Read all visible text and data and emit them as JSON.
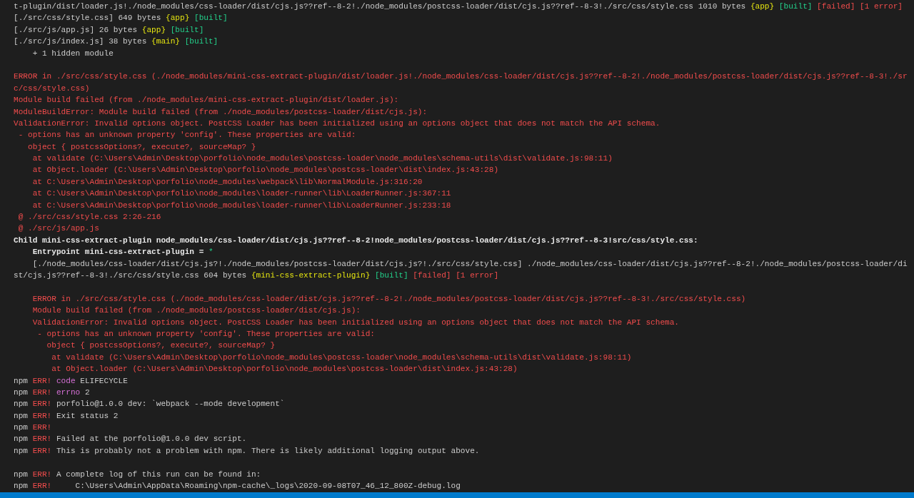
{
  "terminal": {
    "lines": [
      {
        "kind": "text",
        "segments": [
          {
            "text": "t-plugin/dist/loader.js!./node_modules/css-loader/dist/cjs.js??ref--8-2!./node_modules/postcss-loader/dist/cjs.js??ref--8-3!./src/css/style.css 1010 bytes",
            "kind": "plain"
          },
          {
            "text": "{app}",
            "kind": "chunk"
          },
          {
            "text": "[built]",
            "kind": "ok"
          },
          {
            "text": "[failed]",
            "kind": "error"
          },
          {
            "text": "[1 error]",
            "kind": "error"
          }
        ]
      },
      {
        "kind": "text",
        "segments": [
          {
            "text": "[./src/css/style.css] 649 bytes",
            "kind": "plain"
          },
          {
            "text": "{app}",
            "kind": "chunk"
          },
          {
            "text": "[built]",
            "kind": "ok"
          }
        ]
      },
      {
        "kind": "text",
        "segments": [
          {
            "text": "[./src/js/app.js] 26 bytes",
            "kind": "plain"
          },
          {
            "text": "{app}",
            "kind": "chunk"
          },
          {
            "text": "[built]",
            "kind": "ok"
          }
        ]
      },
      {
        "kind": "text",
        "segments": [
          {
            "text": "[./src/js/index.js] 38 bytes",
            "kind": "plain"
          },
          {
            "text": "{main}",
            "kind": "chunk"
          },
          {
            "text": "[built]",
            "kind": "ok"
          }
        ]
      },
      {
        "kind": "text",
        "segments": [
          {
            "text": "    + 1 hidden module",
            "kind": "plain"
          }
        ]
      },
      {
        "kind": "blank"
      },
      {
        "kind": "text",
        "segments": [
          {
            "text": "ERROR in ./src/css/style.css (./node_modules/mini-css-extract-plugin/dist/loader.js!./node_modules/css-loader/dist/cjs.js??ref--8-2!./node_modules/postcss-loader/dist/cjs.js??ref--8-3!./sr",
            "kind": "error"
          }
        ]
      },
      {
        "kind": "text",
        "segments": [
          {
            "text": "c/css/style.css)",
            "kind": "error"
          }
        ]
      },
      {
        "kind": "text",
        "segments": [
          {
            "text": "Module build failed (from ./node_modules/mini-css-extract-plugin/dist/loader.js):",
            "kind": "error"
          }
        ]
      },
      {
        "kind": "text",
        "segments": [
          {
            "text": "ModuleBuildError: Module build failed (from ./node_modules/postcss-loader/dist/cjs.js):",
            "kind": "error"
          }
        ]
      },
      {
        "kind": "text",
        "segments": [
          {
            "text": "ValidationError: Invalid options object. PostCSS Loader has been initialized using an options object that does not match the API schema.",
            "kind": "error"
          }
        ]
      },
      {
        "kind": "text",
        "segments": [
          {
            "text": " - options has an unknown property 'config'. These properties are valid:",
            "kind": "error"
          }
        ]
      },
      {
        "kind": "text",
        "segments": [
          {
            "text": "   object { postcssOptions?, execute?, sourceMap? }",
            "kind": "error"
          }
        ]
      },
      {
        "kind": "text",
        "segments": [
          {
            "text": "    at validate (C:\\Users\\Admin\\Desktop\\porfolio\\node_modules\\postcss-loader\\node_modules\\schema-utils\\dist\\validate.js:98:11)",
            "kind": "error"
          }
        ]
      },
      {
        "kind": "text",
        "segments": [
          {
            "text": "    at Object.loader (C:\\Users\\Admin\\Desktop\\porfolio\\node_modules\\postcss-loader\\dist\\index.js:43:28)",
            "kind": "error"
          }
        ]
      },
      {
        "kind": "text",
        "segments": [
          {
            "text": "    at C:\\Users\\Admin\\Desktop\\porfolio\\node_modules\\webpack\\lib\\NormalModule.js:316:20",
            "kind": "error"
          }
        ]
      },
      {
        "kind": "text",
        "segments": [
          {
            "text": "    at C:\\Users\\Admin\\Desktop\\porfolio\\node_modules\\loader-runner\\lib\\LoaderRunner.js:367:11",
            "kind": "error"
          }
        ]
      },
      {
        "kind": "text",
        "segments": [
          {
            "text": "    at C:\\Users\\Admin\\Desktop\\porfolio\\node_modules\\loader-runner\\lib\\LoaderRunner.js:233:18",
            "kind": "error"
          }
        ]
      },
      {
        "kind": "text",
        "segments": [
          {
            "text": " @ ./src/css/style.css 2:26-216",
            "kind": "error"
          }
        ]
      },
      {
        "kind": "text",
        "segments": [
          {
            "text": " @ ./src/js/app.js",
            "kind": "error"
          }
        ]
      },
      {
        "kind": "text",
        "segments": [
          {
            "text": "Child mini-css-extract-plugin node_modules/css-loader/dist/cjs.js??ref--8-2!node_modules/postcss-loader/dist/cjs.js??ref--8-3!src/css/style.css:",
            "kind": "bold"
          }
        ]
      },
      {
        "kind": "text",
        "segments": [
          {
            "text": "    Entrypoint mini-css-extract-plugin =",
            "kind": "bold"
          },
          {
            "text": "*",
            "kind": "ok"
          }
        ]
      },
      {
        "kind": "text",
        "segments": [
          {
            "text": "    [./node_modules/css-loader/dist/cjs.js?!./node_modules/postcss-loader/dist/cjs.js?!./src/css/style.css] ./node_modules/css-loader/dist/cjs.js??ref--8-2!./node_modules/postcss-loader/di",
            "kind": "plain"
          }
        ]
      },
      {
        "kind": "text",
        "segments": [
          {
            "text": "st/cjs.js??ref--8-3!./src/css/style.css 604 bytes",
            "kind": "plain"
          },
          {
            "text": "{mini-css-extract-plugin}",
            "kind": "chunk"
          },
          {
            "text": "[built]",
            "kind": "ok"
          },
          {
            "text": "[failed]",
            "kind": "error"
          },
          {
            "text": "[1 error]",
            "kind": "error"
          }
        ]
      },
      {
        "kind": "blank"
      },
      {
        "kind": "text",
        "segments": [
          {
            "text": "    ERROR in ./src/css/style.css (./node_modules/css-loader/dist/cjs.js??ref--8-2!./node_modules/postcss-loader/dist/cjs.js??ref--8-3!./src/css/style.css)",
            "kind": "error"
          }
        ]
      },
      {
        "kind": "text",
        "segments": [
          {
            "text": "    Module build failed (from ./node_modules/postcss-loader/dist/cjs.js):",
            "kind": "error"
          }
        ]
      },
      {
        "kind": "text",
        "segments": [
          {
            "text": "    ValidationError: Invalid options object. PostCSS Loader has been initialized using an options object that does not match the API schema.",
            "kind": "error"
          }
        ]
      },
      {
        "kind": "text",
        "segments": [
          {
            "text": "     - options has an unknown property 'config'. These properties are valid:",
            "kind": "error"
          }
        ]
      },
      {
        "kind": "text",
        "segments": [
          {
            "text": "       object { postcssOptions?, execute?, sourceMap? }",
            "kind": "error"
          }
        ]
      },
      {
        "kind": "text",
        "segments": [
          {
            "text": "        at validate (C:\\Users\\Admin\\Desktop\\porfolio\\node_modules\\postcss-loader\\node_modules\\schema-utils\\dist\\validate.js:98:11)",
            "kind": "error"
          }
        ]
      },
      {
        "kind": "text",
        "segments": [
          {
            "text": "        at Object.loader (C:\\Users\\Admin\\Desktop\\porfolio\\node_modules\\postcss-loader\\dist\\index.js:43:28)",
            "kind": "error"
          }
        ]
      },
      {
        "kind": "text",
        "segments": [
          {
            "text": "npm",
            "kind": "plain"
          },
          {
            "text": "ERR!",
            "kind": "error"
          },
          {
            "text": "code",
            "kind": "keyword"
          },
          {
            "text": "ELIFECYCLE",
            "kind": "plain"
          }
        ]
      },
      {
        "kind": "text",
        "segments": [
          {
            "text": "npm",
            "kind": "plain"
          },
          {
            "text": "ERR!",
            "kind": "error"
          },
          {
            "text": "errno",
            "kind": "keyword"
          },
          {
            "text": "2",
            "kind": "plain"
          }
        ]
      },
      {
        "kind": "text",
        "segments": [
          {
            "text": "npm",
            "kind": "plain"
          },
          {
            "text": "ERR!",
            "kind": "error"
          },
          {
            "text": "porfolio@1.0.0 dev: `webpack --mode development`",
            "kind": "plain"
          }
        ]
      },
      {
        "kind": "text",
        "segments": [
          {
            "text": "npm",
            "kind": "plain"
          },
          {
            "text": "ERR!",
            "kind": "error"
          },
          {
            "text": "Exit status 2",
            "kind": "plain"
          }
        ]
      },
      {
        "kind": "text",
        "segments": [
          {
            "text": "npm",
            "kind": "plain"
          },
          {
            "text": "ERR!",
            "kind": "error"
          }
        ]
      },
      {
        "kind": "text",
        "segments": [
          {
            "text": "npm",
            "kind": "plain"
          },
          {
            "text": "ERR!",
            "kind": "error"
          },
          {
            "text": "Failed at the porfolio@1.0.0 dev script.",
            "kind": "plain"
          }
        ]
      },
      {
        "kind": "text",
        "segments": [
          {
            "text": "npm",
            "kind": "plain"
          },
          {
            "text": "ERR!",
            "kind": "error"
          },
          {
            "text": "This is probably not a problem with npm. There is likely additional logging output above.",
            "kind": "plain"
          }
        ]
      },
      {
        "kind": "blank"
      },
      {
        "kind": "text",
        "segments": [
          {
            "text": "npm",
            "kind": "plain"
          },
          {
            "text": "ERR!",
            "kind": "error"
          },
          {
            "text": "A complete log of this run can be found in:",
            "kind": "plain"
          }
        ]
      },
      {
        "kind": "text",
        "segments": [
          {
            "text": "npm",
            "kind": "plain"
          },
          {
            "text": "ERR!",
            "kind": "error"
          },
          {
            "text": "    C:\\Users\\Admin\\AppData\\Roaming\\npm-cache\\_logs\\2020-09-08T07_46_12_800Z-debug.log",
            "kind": "plain"
          }
        ]
      }
    ]
  }
}
